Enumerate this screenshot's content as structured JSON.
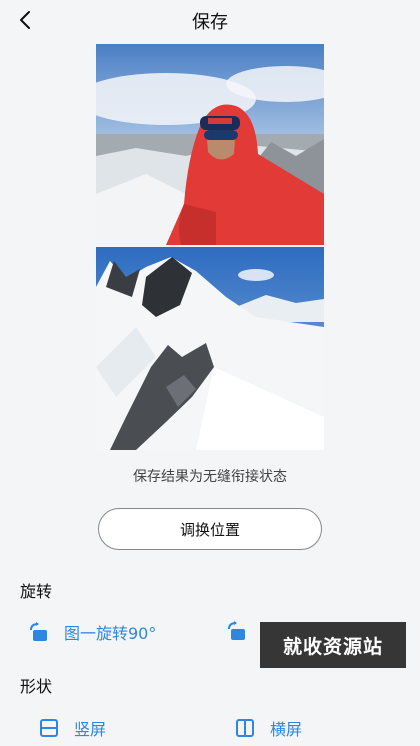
{
  "header": {
    "title": "保存",
    "back_icon": "chevron-left-icon"
  },
  "preview": {
    "top_image": "climber-selfie-snow-mountain",
    "bottom_image": "snowy-rocky-ridge"
  },
  "caption": "保存结果为无缝衔接状态",
  "swap_button_label": "调换位置",
  "rotation": {
    "label": "旋转",
    "options": [
      {
        "label": "图一旋转90°",
        "icon": "rotate-icon"
      },
      {
        "label": "",
        "icon": "rotate-icon"
      }
    ]
  },
  "shape": {
    "label": "形状",
    "options": [
      {
        "label": "竖屏",
        "icon": "split-horizontal-icon"
      },
      {
        "label": "横屏",
        "icon": "split-vertical-icon"
      }
    ]
  },
  "watermark_text": "就收资源站",
  "colors": {
    "accent": "#2f86e0",
    "background": "#f4f5f7"
  }
}
